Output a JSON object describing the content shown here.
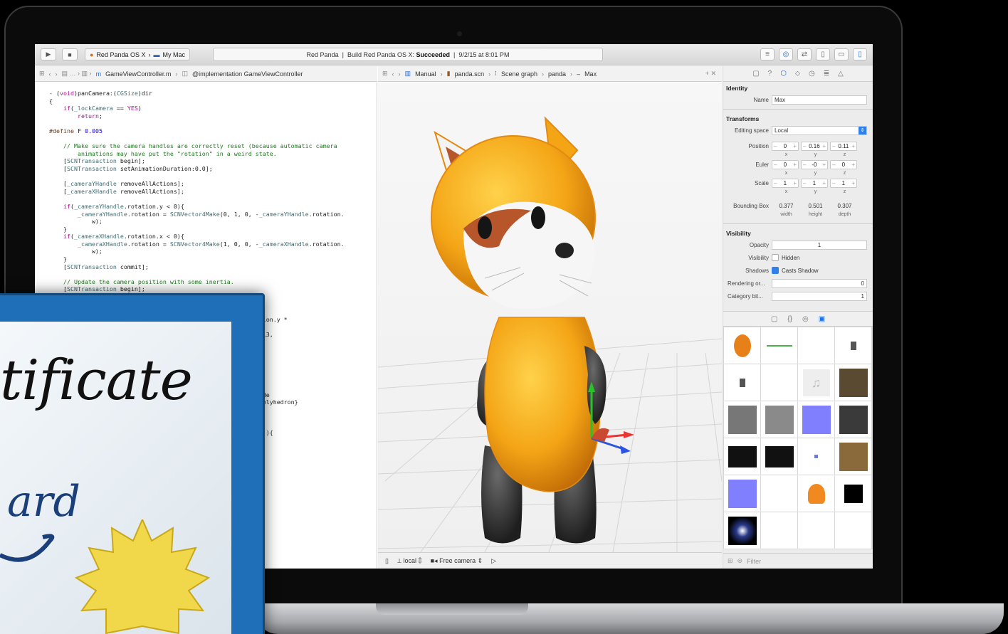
{
  "toolbar": {
    "scheme_project": "Red Panda OS X",
    "scheme_device": "My Mac",
    "activity_project": "Red Panda",
    "activity_build": "Build Red Panda OS X:",
    "activity_status": "Succeeded",
    "activity_time": "9/2/15 at 8:01 PM"
  },
  "code_jumpbar": {
    "file": "GameViewController.m",
    "symbol": "@implementation GameViewController"
  },
  "scene_jumpbar": {
    "folder": "Manual",
    "file": "panda.scn",
    "graph": "Scene graph",
    "node": "panda",
    "leaf": "Max"
  },
  "code_lines": [
    "- (void)panCamera:(CGSize)dir",
    "{",
    "    if(_lockCamera == YES)",
    "        return;",
    "",
    "#define F 0.005",
    "",
    "    // Make sure the camera handles are correctly reset (because automatic camera",
    "        animations may have put the \"rotation\" in a weird state.",
    "    [SCNTransaction begin];",
    "    [SCNTransaction setAnimationDuration:0.0];",
    "",
    "    [_cameraYHandle removeAllActions];",
    "    [_cameraXHandle removeAllActions];",
    "",
    "    if(_cameraYHandle.rotation.y < 0){",
    "        _cameraYHandle.rotation = SCNVector4Make(0, 1, 0, -_cameraYHandle.rotation.",
    "            w);",
    "    }",
    "    if(_cameraXHandle.rotation.x < 0){",
    "        _cameraXHandle.rotation = SCNVector4Make(1, 0, 0, -_cameraXHandle.rotation.",
    "            w);",
    "    }",
    "    [SCNTransaction commit];",
    "",
    "    // Update the camera position with some inertia.",
    "    [SCNTransaction begin];",
    "                                          TimingFunction",
    "                                          ;",
    "",
    "                                          ameraYHandle.rotation.y *",
    "",
    "                                          AX(-M_PI_2, MIN(0.13,",
    "",
    "",
    "",
    "",
    "",
    "",
    "                                          goryBit;",
    "                                            shapeWithNode:node",
    "                                          sShapeTypeConcavePolyhedron}",
    "",
    "",
    "",
    "                                          ring:@\"grass-area\"]){",
    "",
    "                                          ;",
    "",
    "                                          ;"
  ],
  "scene_bottom": {
    "space": "local",
    "camera": "Free camera"
  },
  "inspector": {
    "identity_title": "Identity",
    "name_label": "Name",
    "name_value": "Max",
    "transforms_title": "Transforms",
    "editing_space_label": "Editing space",
    "editing_space_value": "Local",
    "position_label": "Position",
    "position": [
      "0",
      "0.16",
      "0.11"
    ],
    "euler_label": "Euler",
    "euler": [
      "0",
      "-0",
      "0"
    ],
    "scale_label": "Scale",
    "scale": [
      "1",
      "1",
      "1"
    ],
    "axes": [
      "x",
      "y",
      "z"
    ],
    "bbox_label": "Bounding Box",
    "bbox_values": [
      "0.377",
      "0.501",
      "0.307"
    ],
    "bbox_axes": [
      "width",
      "height",
      "depth"
    ],
    "visibility_title": "Visibility",
    "opacity_label": "Opacity",
    "opacity_value": "1",
    "visibility_label": "Visibility",
    "hidden_label": "Hidden",
    "shadows_label": "Shadows",
    "casts_shadow_label": "Casts Shadow",
    "rendering_label": "Rendering or...",
    "rendering_value": "0",
    "category_label": "Category bit...",
    "category_value": "1",
    "filter_placeholder": "Filter"
  },
  "certificate": {
    "word": "tificate",
    "word2": "ard"
  }
}
